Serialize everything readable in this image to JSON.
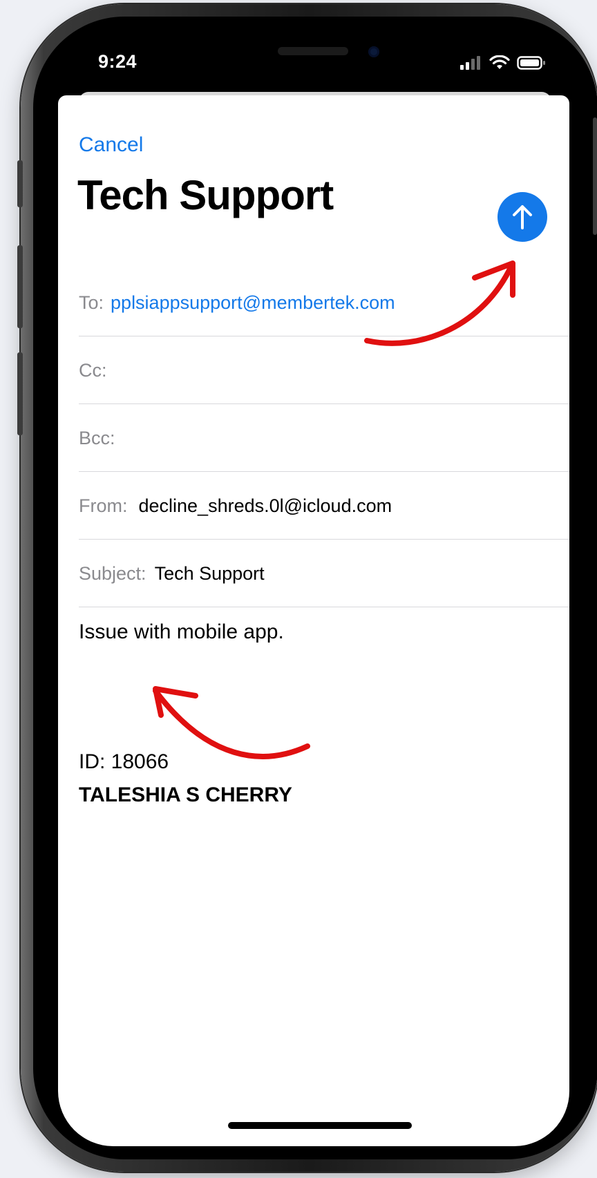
{
  "status_bar": {
    "time": "9:24",
    "icons": [
      "signal-icon",
      "wifi-icon",
      "battery-icon"
    ]
  },
  "compose": {
    "cancel_label": "Cancel",
    "title": "Tech Support",
    "send_icon": "arrow-up-icon",
    "to_label": "To:",
    "to_value": "pplsiappsupport@membertek.com",
    "cc_label": "Cc:",
    "bcc_label": "Bcc:",
    "from_label": "From:",
    "from_value": "decline_shreds.0l@icloud.com",
    "subject_label": "Subject:",
    "subject_value": "Tech Support",
    "body_line1": "Issue with mobile app.",
    "body_id": "ID: 18066",
    "body_name": "TALESHIA S CHERRY"
  },
  "colors": {
    "accent": "#1479e9",
    "annotation_arrow": "#e01010",
    "background": "#eef0f5"
  }
}
